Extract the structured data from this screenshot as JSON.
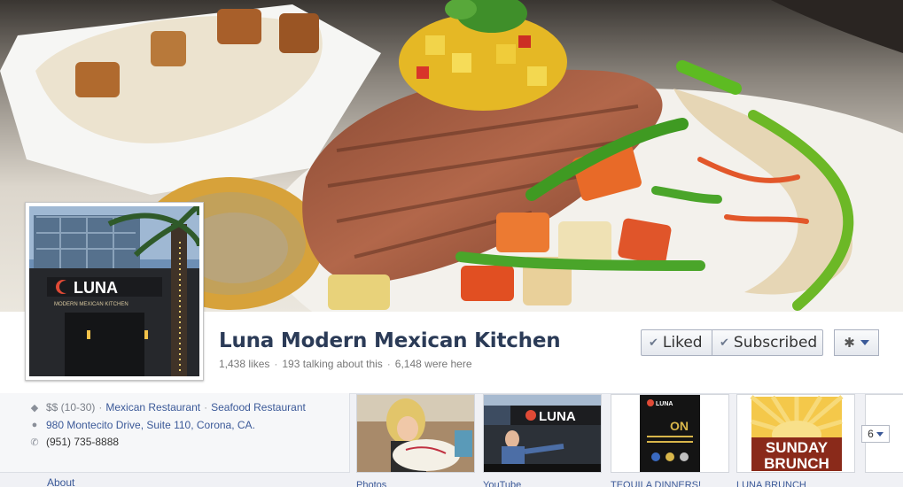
{
  "page": {
    "title": "Luna Modern Mexican Kitchen",
    "stats": [
      "1,438 likes",
      "193 talking about this",
      "6,148 were here"
    ]
  },
  "actions": {
    "liked_label": "Liked",
    "subscribed_label": "Subscribed",
    "gear_icon": "gear-icon"
  },
  "profile": {
    "logo_text": "LUNA",
    "logo_subtext": "MODERN MEXICAN KITCHEN"
  },
  "info": {
    "price": "$$ (10-30)",
    "categories": [
      "Mexican Restaurant",
      "Seafood Restaurant"
    ],
    "address": "980 Montecito Drive, Suite 110, Corona, CA.",
    "phone": "(951) 735-8888",
    "about_label": "About"
  },
  "apps": [
    {
      "label": "Photos"
    },
    {
      "label": "YouTube",
      "logo_text": "LUNA"
    },
    {
      "label": "TEQUILA DINNERS!",
      "logo_text": "LUNA"
    },
    {
      "label": "LUNA BRUNCH",
      "line1": "SUNDAY",
      "line2": "BRUNCH"
    }
  ],
  "apps_count": "6",
  "colors": {
    "link": "#3b5998",
    "title": "#2b3b57"
  }
}
